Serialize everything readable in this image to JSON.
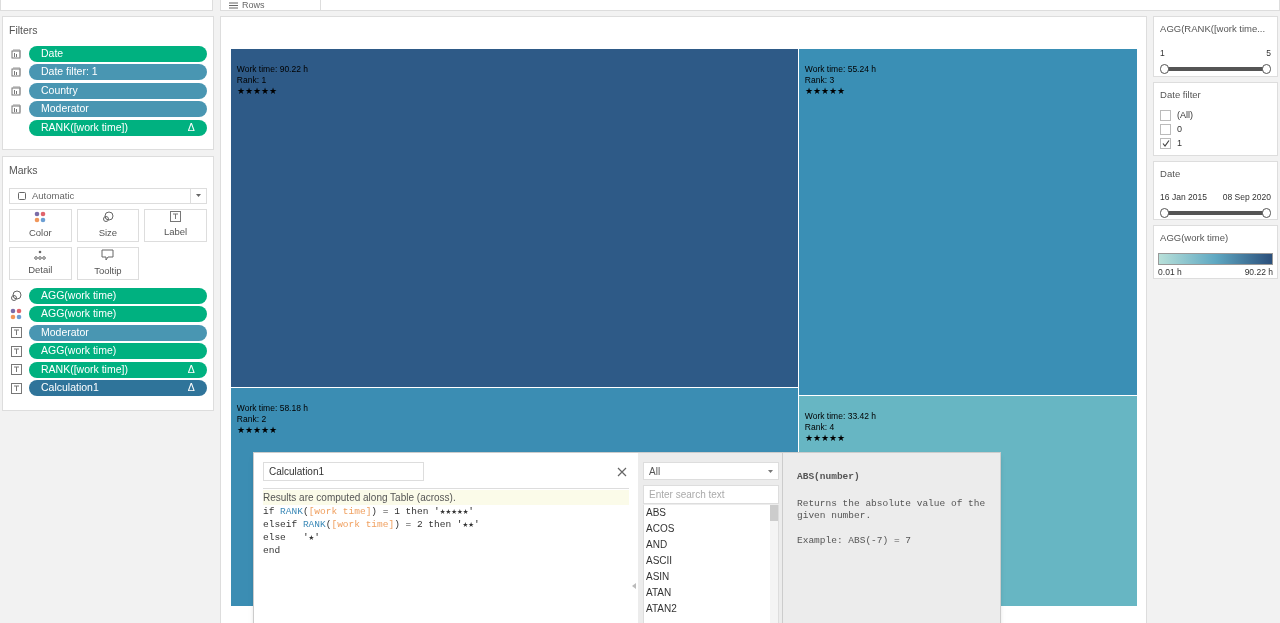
{
  "top_shelf": {
    "label": "Rows"
  },
  "filters": {
    "title": "Filters",
    "pills": [
      {
        "label": "Date",
        "kind": "filter",
        "color": "#00b180"
      },
      {
        "label": "Date filter: 1",
        "kind": "filter",
        "color": "#4996b2"
      },
      {
        "label": "Country",
        "kind": "filter",
        "color": "#4996b2"
      },
      {
        "label": "Moderator",
        "kind": "filter",
        "color": "#4996b2"
      },
      {
        "label": "RANK([work time])",
        "kind": "plain",
        "color": "#00b180",
        "flag": "Δ"
      }
    ]
  },
  "marks": {
    "title": "Marks",
    "mark_type": "Automatic",
    "cards": [
      {
        "label": "Color",
        "kind": "color"
      },
      {
        "label": "Size",
        "kind": "size"
      },
      {
        "label": "Label",
        "kind": "text"
      },
      {
        "label": "Detail",
        "kind": "detail"
      },
      {
        "label": "Tooltip",
        "kind": "tooltip"
      }
    ],
    "pills": [
      {
        "label": "AGG(work time)",
        "kind": "size",
        "color": "#00b180"
      },
      {
        "label": "AGG(work time)",
        "kind": "color",
        "color": "#00b180"
      },
      {
        "label": "Moderator",
        "kind": "text",
        "color": "#4996b2"
      },
      {
        "label": "AGG(work time)",
        "kind": "text",
        "color": "#00b180"
      },
      {
        "label": "RANK([work time])",
        "kind": "text",
        "color": "#00b180",
        "flag": "Δ"
      },
      {
        "label": "Calculation1",
        "kind": "text",
        "color": "#2f749a",
        "flag": "Δ"
      }
    ]
  },
  "treemap": {
    "columns": [
      {
        "tiles": [
          {
            "work_time": "Work time: 90.22  h",
            "rank": "Rank: 1",
            "stars": "★★★★★",
            "color": "#2e5a87"
          },
          {
            "work_time": "Work time: 58.18  h",
            "rank": "Rank: 2",
            "stars": "★★★★★",
            "color": "#3b8db3"
          }
        ]
      },
      {
        "tiles": [
          {
            "work_time": "Work time: 55.24  h",
            "rank": "Rank: 3",
            "stars": "★★★★★",
            "color": "#3a8fb5"
          },
          {
            "work_time": "Work time: 33.42  h",
            "rank": "Rank: 4",
            "stars": "★★★★★",
            "color": "#67b6c3"
          }
        ]
      }
    ]
  },
  "calc_dialog": {
    "name": "Calculation1",
    "notice": "Results are computed along Table (across).",
    "code": [
      [
        {
          "text": "if ",
          "kind": "keyword"
        },
        {
          "text": "RANK",
          "kind": "function"
        },
        {
          "text": "(",
          "kind": "plain"
        },
        {
          "text": "[work time]",
          "kind": "field"
        },
        {
          "text": ") = 1 then '★★★★★'",
          "kind": "plain"
        }
      ],
      [
        {
          "text": "elseif ",
          "kind": "keyword"
        },
        {
          "text": "RANK",
          "kind": "function"
        },
        {
          "text": "(",
          "kind": "plain"
        },
        {
          "text": "[work time]",
          "kind": "field"
        },
        {
          "text": ") = 2 then '★★'",
          "kind": "plain"
        }
      ],
      [
        {
          "text": "else   '★'",
          "kind": "keyword"
        }
      ],
      [
        {
          "text": "end",
          "kind": "keyword"
        }
      ]
    ],
    "category": "All",
    "search_placeholder": "Enter search text",
    "functions": [
      "ABS",
      "ACOS",
      "AND",
      "ASCII",
      "ASIN",
      "ATAN",
      "ATAN2"
    ],
    "doc_title": "ABS(number)",
    "doc_body": "Returns the absolute value of the given number.",
    "doc_example": "Example: ABS(-7) = 7"
  },
  "right_panels": {
    "rank_filter": {
      "title": "AGG(RANK([work time...",
      "min": "1",
      "max": "5",
      "level": 1
    },
    "date_filter": {
      "title": "Date filter",
      "options": [
        {
          "label": "(All)",
          "checked": false
        },
        {
          "label": "0",
          "checked": false
        },
        {
          "label": "1",
          "checked": true
        }
      ]
    },
    "date_range": {
      "title": "Date",
      "start": "16 Jan 2015",
      "end": "08 Sep 2020",
      "level": 1
    },
    "legend": {
      "title": "AGG(work time)",
      "min": "0.01  h",
      "max": "90.22  h"
    }
  }
}
